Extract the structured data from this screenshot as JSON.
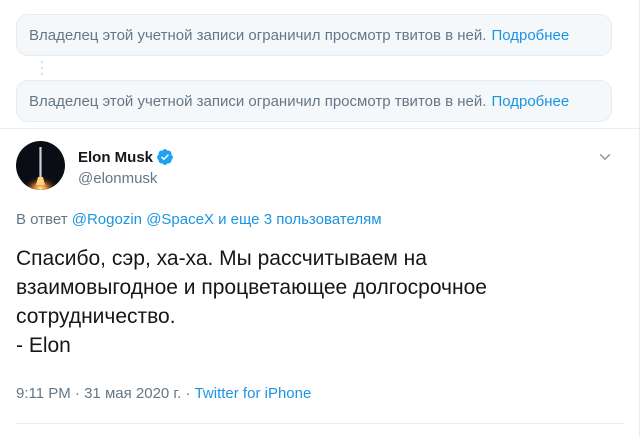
{
  "withheld_notices": [
    {
      "text": "Владелец этой учетной записи ограничил просмотр твитов в ней.",
      "link": "Подробнее"
    },
    {
      "text": "Владелец этой учетной записи ограничил просмотр твитов в ней.",
      "link": "Подробнее"
    }
  ],
  "tweet": {
    "author": {
      "name": "Elon Musk",
      "handle": "@elonmusk",
      "avatar_icon": "rocket-launch-avatar",
      "verified_icon": "verified-badge-icon"
    },
    "reply_to": {
      "prefix": "В ответ",
      "mentions": [
        "@Rogozin",
        "@SpaceX"
      ],
      "suffix": "и еще 3 пользователям"
    },
    "text_lines": [
      "Спасибо, сэр, ха-ха. Мы рассчитываем на",
      "взаимовыгодное и процветающее долгосрочное",
      "сотрудничество.",
      "- Elon"
    ],
    "time": "9:11 PM",
    "separator": "·",
    "date": "31 мая 2020 г.",
    "source": "Twitter for iPhone"
  },
  "colors": {
    "link": "#1b95e0",
    "verified": "#1da1f2",
    "secondary_text": "#657786",
    "border": "#e6ecf0"
  }
}
